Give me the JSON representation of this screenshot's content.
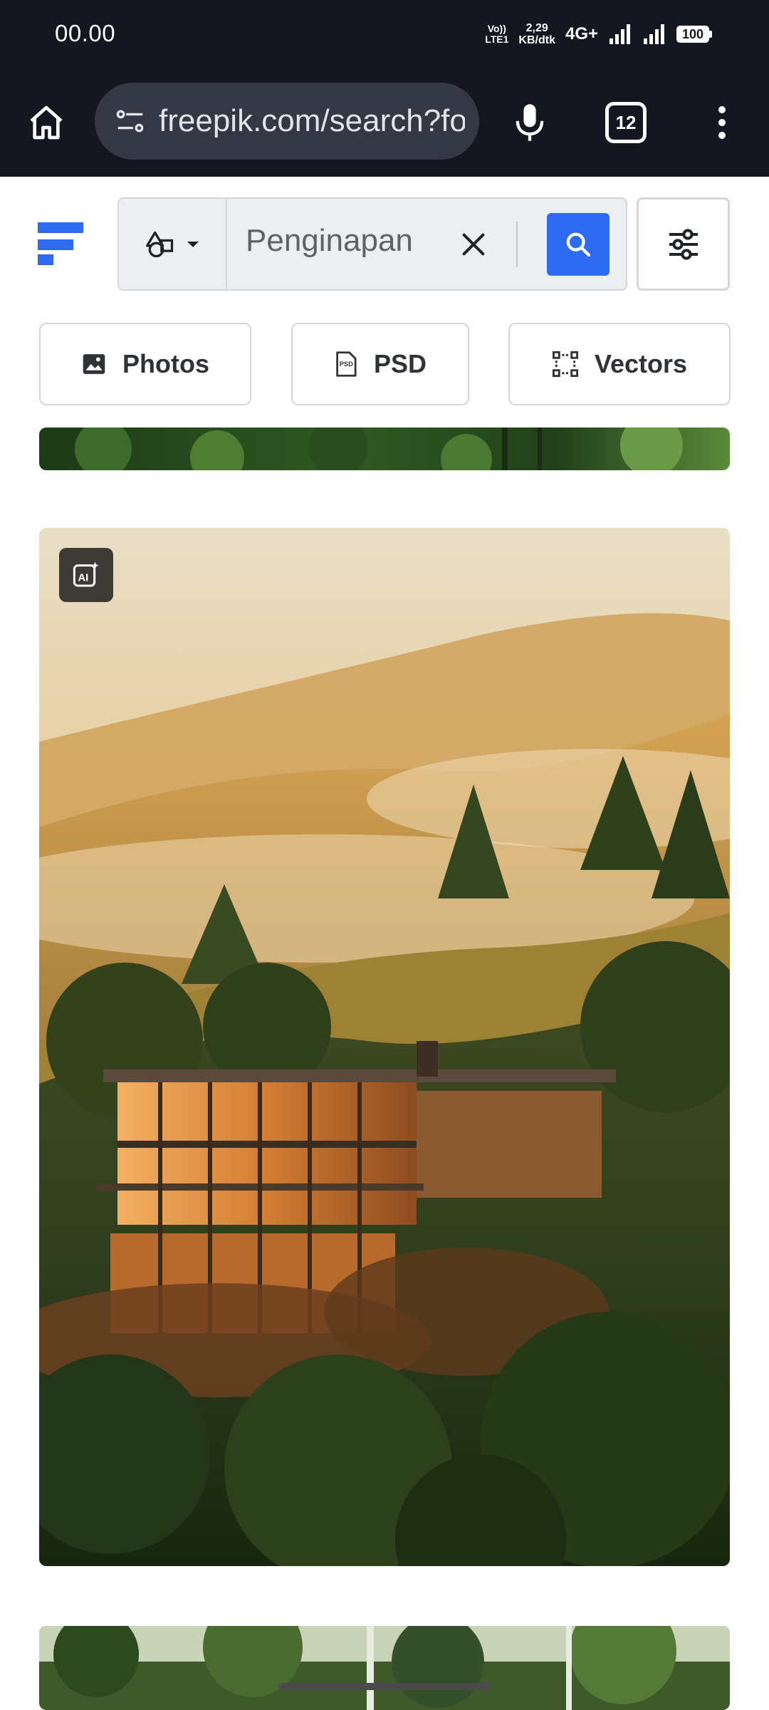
{
  "status_bar": {
    "time": "00.00",
    "volte_line1": "Vo))",
    "volte_line2": "LTE1",
    "speed_line1": "2,29",
    "speed_line2": "KB/dtk",
    "network": "4G+",
    "battery": "100"
  },
  "browser": {
    "url": "freepik.com/search?format=search&query=Penginapan",
    "tab_count": "12",
    "icons": [
      "home-icon",
      "site-info-icon",
      "microphone-icon",
      "tabs-icon",
      "more-vert-icon"
    ]
  },
  "header": {
    "search_value": "Penginapan",
    "icons": [
      "freepik-logo",
      "shapes-icon",
      "caret-down-icon",
      "close-icon",
      "search-icon",
      "sliders-icon"
    ],
    "accent": "#2f6bf2"
  },
  "chips": [
    {
      "label": "Photos",
      "icon": "image-icon"
    },
    {
      "label": "PSD",
      "icon": "psd-file-icon"
    },
    {
      "label": "Vectors",
      "icon": "vector-icon"
    }
  ],
  "results": {
    "main_image_badge": "ai-generated-icon"
  }
}
